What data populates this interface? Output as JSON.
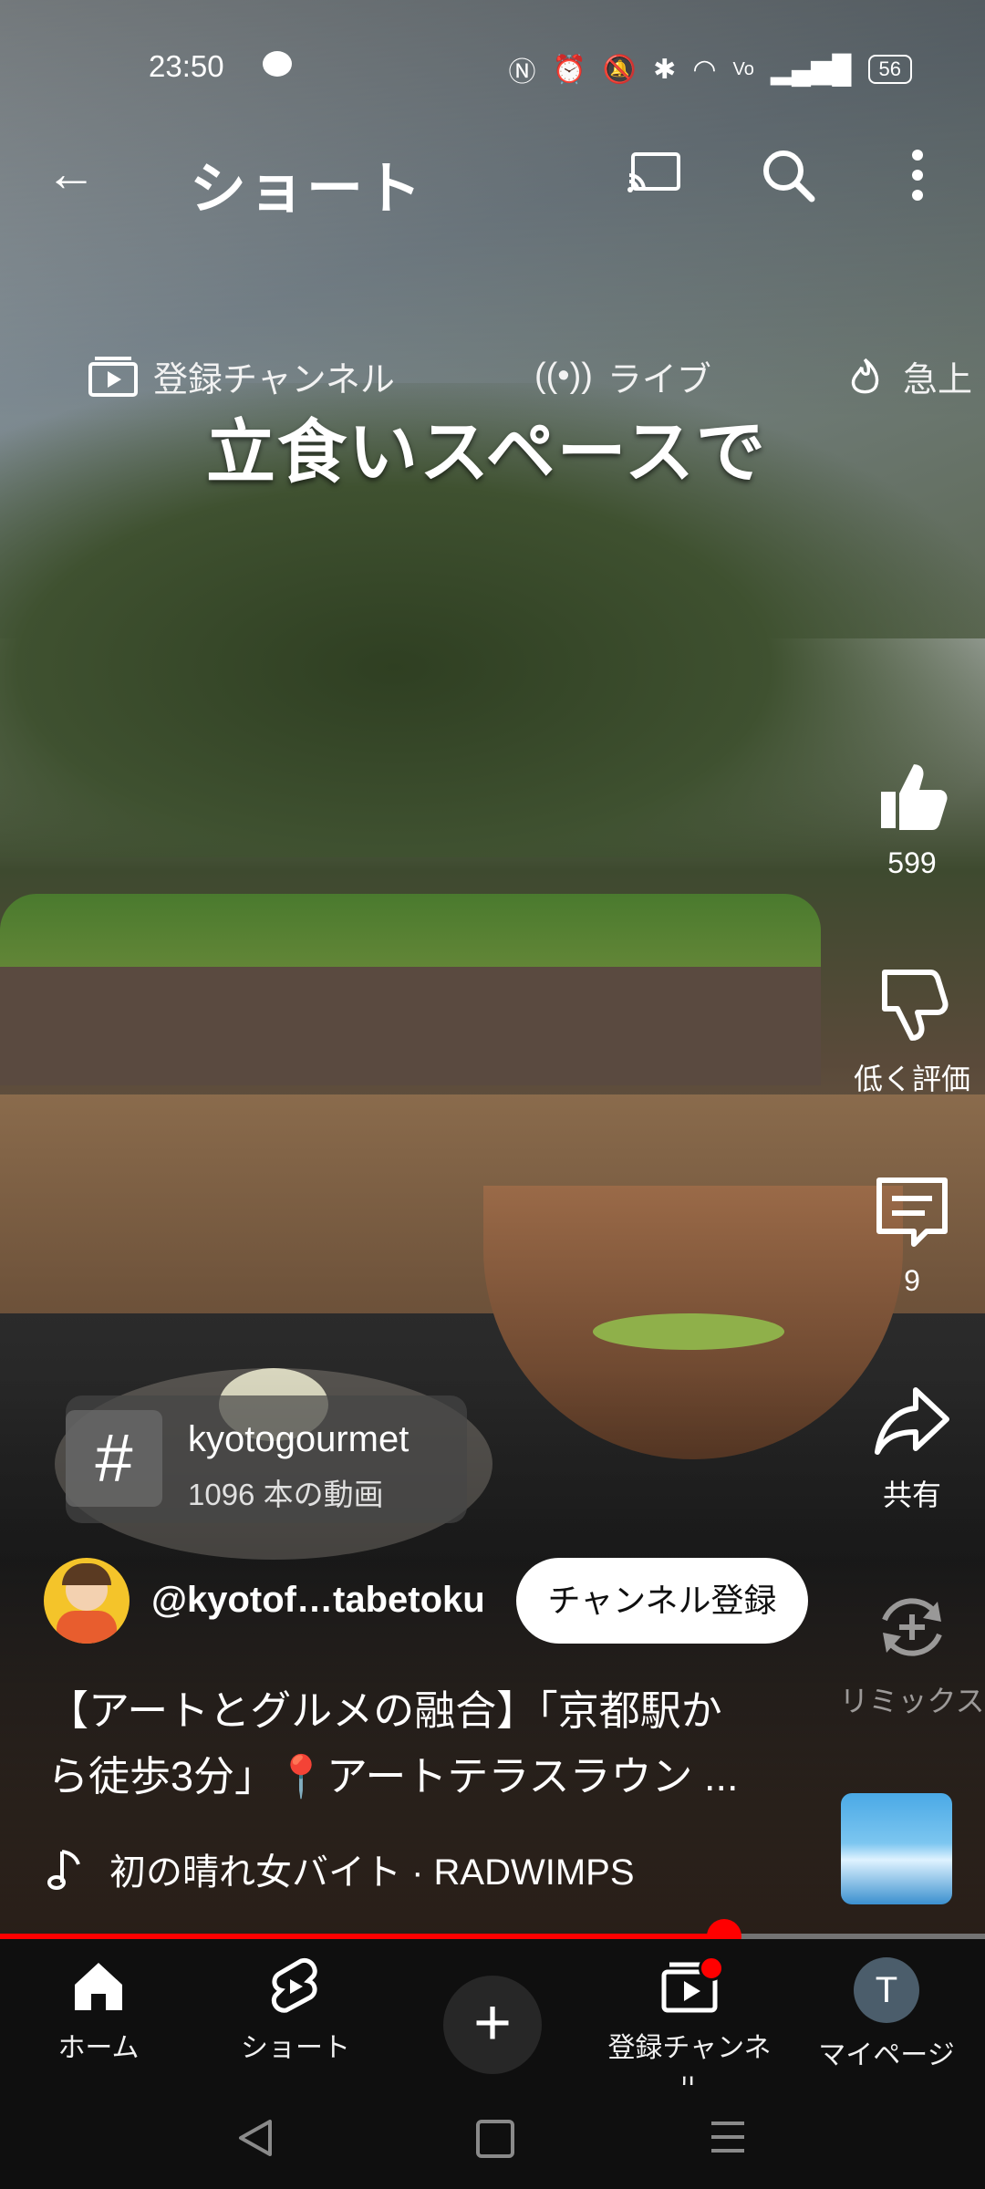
{
  "status": {
    "time": "23:50",
    "battery": "56"
  },
  "header": {
    "title": "ショート"
  },
  "chips": {
    "subscriptions": "登録チャンネル",
    "live": "ライブ",
    "trending": "急上"
  },
  "caption": "立食いスペースで",
  "actions": {
    "like_count": "599",
    "dislike_label": "低く評価",
    "comment_count": "9",
    "share_label": "共有",
    "remix_label": "リミックス"
  },
  "hashtag": {
    "symbol": "#",
    "name": "kyotogourmet",
    "count": "1096 本の動画"
  },
  "channel": {
    "handle": "@kyotof…tabetoku",
    "subscribe_label": "チャンネル登録"
  },
  "description": {
    "line1": "【アートとグルメの融合】「京都駅か",
    "line2": "ら徒歩3分」📍アートテラスラウン ..."
  },
  "music": {
    "text": "初の晴れ女バイト · RADWIMPS"
  },
  "progress": {
    "played_fraction": 0.735
  },
  "bottom_nav": {
    "home": "ホーム",
    "shorts": "ショート",
    "subscriptions": "登録チャンネル",
    "mypage": "マイページ",
    "avatar_letter": "T"
  },
  "colors": {
    "accent": "#ff0000",
    "nav_bg": "#0f0f0f"
  }
}
